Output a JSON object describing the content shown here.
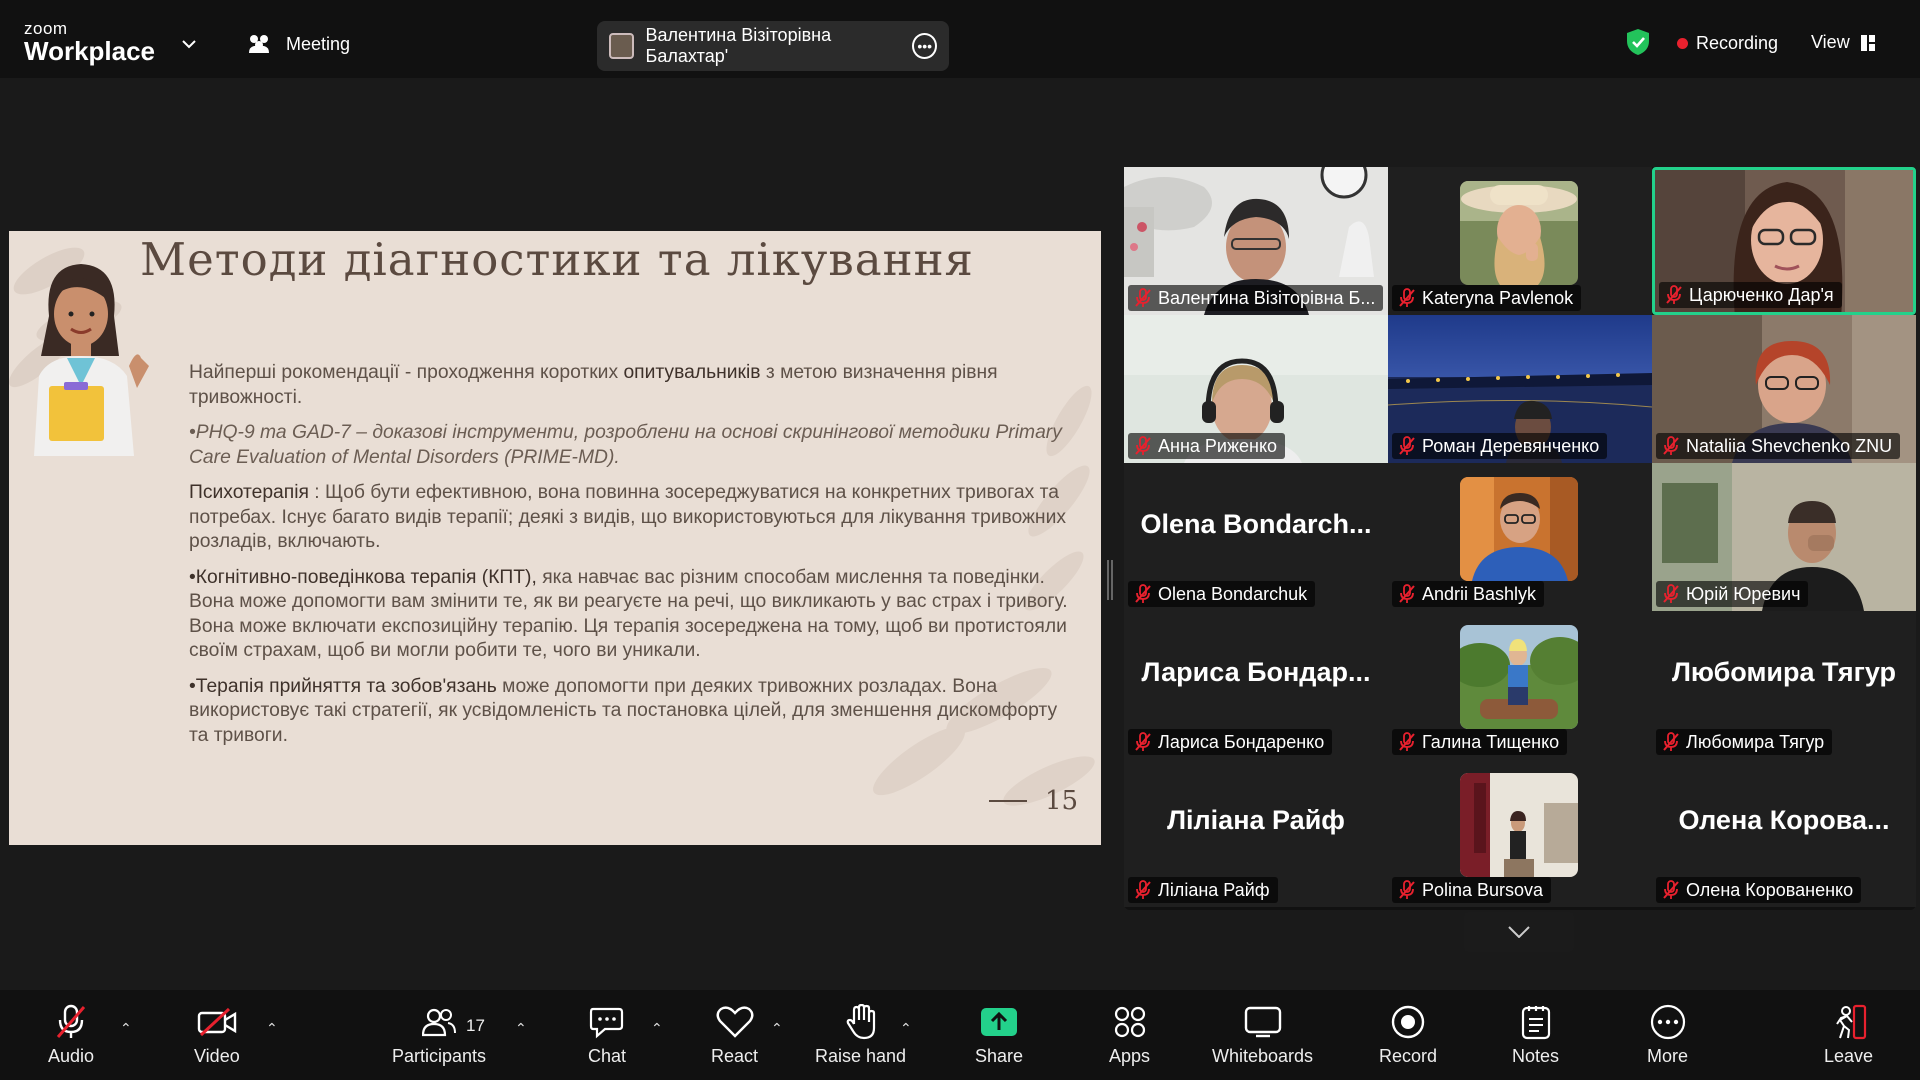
{
  "app": {
    "brand_top": "zoom",
    "brand_bottom": "Workplace"
  },
  "header": {
    "meeting_label": "Meeting",
    "active_speaker": "Валентина Візіторівна Балахтар'",
    "recording_label": "Recording",
    "view_label": "View"
  },
  "slide": {
    "title": "Методи діагностики та  лікування",
    "p1_pre": "Найперші  рокомендації - проходження коротких ",
    "p1_bold": "опитувальників",
    "p1_post": " з метою визначення рівня тривожності.",
    "p2": "•PHQ-9 та GAD-7 – доказові інструменти, розроблени на основі скринінгової методики Primary Care Evaluation of Mental Disorders (PRIME-MD).",
    "p3_bold": "Психотерапія",
    "p3_post": " : Щоб бути ефективною, вона повинна зосереджуватися на конкретних тривогах та потребах. Існує багато видів терапії; деякі з видів, що використовуються для лікування тривожних розладів, включають.",
    "p4_bold": "•Когнітивно-поведінкова терапія (КПТ),",
    "p4_post": " яка навчає вас різним способам мислення та поведінки. Вона може допомогти вам змінити те, як ви реагуєте на речі, що викликають у вас страх і тривогу. Вона може включати експозиційну терапію. Ця терапія зосереджена на тому, щоб ви протистояли своїм страхам, щоб ви могли робити те, чого ви уникали.",
    "p5_bold": "•Терапія прийняття та зобов'язань",
    "p5_post": " може допомогти при деяких тривожних розладах. Вона використовує такі стратегії, як усвідомленість та постановка цілей, для зменшення дискомфорту та тривоги.",
    "page_number": "15"
  },
  "participants": [
    {
      "name": "Валентина Візіторівна Б...",
      "big": "",
      "video": "office"
    },
    {
      "name": "Kateryna Pavlenok",
      "big": "",
      "video": "hat"
    },
    {
      "name": "Царюченко Дар'я",
      "big": "",
      "video": "girl"
    },
    {
      "name": "Анна Риженко",
      "big": "",
      "video": "headset"
    },
    {
      "name": "Роман Деревянченко",
      "big": "",
      "video": "bridge"
    },
    {
      "name": "Nataliia Shevchenko ZNU",
      "big": "",
      "video": "redhair"
    },
    {
      "name": "Olena Bondarchuk",
      "big": "Olena  Bondarch...",
      "video": ""
    },
    {
      "name": "Andrii Bashlyk",
      "big": "",
      "video": "blueman"
    },
    {
      "name": "Юрій Юревич",
      "big": "",
      "video": "man"
    },
    {
      "name": "Лариса Бондаренко",
      "big": "Лариса  Бондар...",
      "video": ""
    },
    {
      "name": "Галина Тищенко",
      "big": "",
      "video": "park"
    },
    {
      "name": "Любомира Тягур",
      "big": "Любомира Тягур",
      "video": ""
    },
    {
      "name": "Ліліана Райф",
      "big": "Ліліана Райф",
      "video": ""
    },
    {
      "name": "Polina Bursova",
      "big": "",
      "video": "room"
    },
    {
      "name": "Олена Корованенко",
      "big": "Олена  Корова...",
      "video": ""
    }
  ],
  "toolbar": {
    "audio": "Audio",
    "video": "Video",
    "participants": "Participants",
    "participants_count": "17",
    "chat": "Chat",
    "react": "React",
    "raise_hand": "Raise hand",
    "share": "Share",
    "apps": "Apps",
    "whiteboards": "Whiteboards",
    "record": "Record",
    "notes": "Notes",
    "more": "More",
    "leave": "Leave"
  },
  "colors": {
    "active_tile": "#23d18b",
    "share_green": "#23d18b",
    "record_red": "#e8212e",
    "muted_red": "#e8212e",
    "slide_bg": "#e9ded5"
  }
}
